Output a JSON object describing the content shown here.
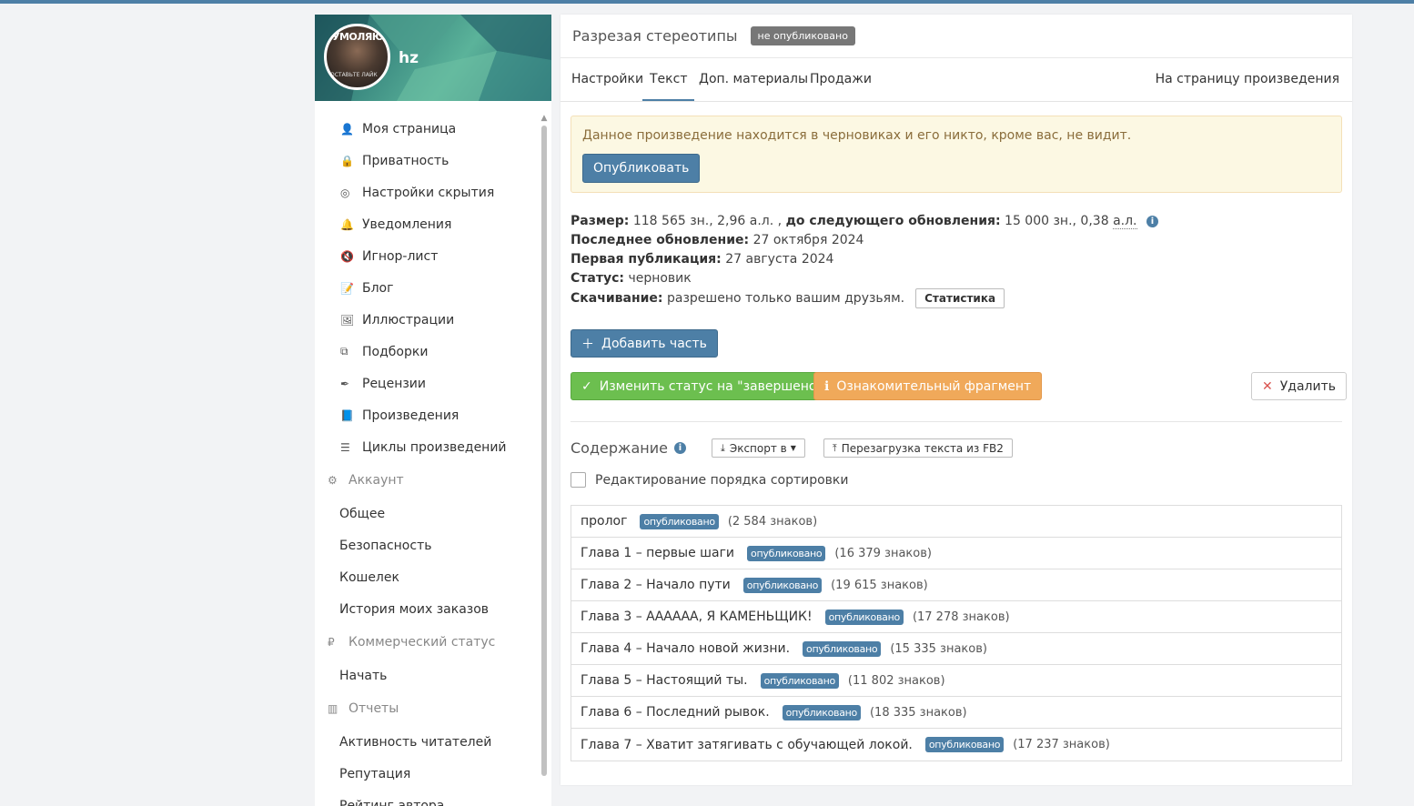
{
  "profile": {
    "username": "hz",
    "avatar_text_top": "УМОЛЯЮ",
    "avatar_text_bottom": "ОСТАВЬТЕ ЛАЙК"
  },
  "sidebar": {
    "items": [
      {
        "label": "Моя страница",
        "icon": "user-icon"
      },
      {
        "label": "Приватность",
        "icon": "lock-icon"
      },
      {
        "label": "Настройки скрытия",
        "icon": "eye-slash-icon"
      },
      {
        "label": "Уведомления",
        "icon": "bell-icon"
      },
      {
        "label": "Игнор-лист",
        "icon": "mute-icon"
      },
      {
        "label": "Блог",
        "icon": "blog-icon"
      },
      {
        "label": "Иллюстрации",
        "icon": "image-icon"
      },
      {
        "label": "Подборки",
        "icon": "collection-icon"
      },
      {
        "label": "Рецензии",
        "icon": "quill-icon"
      },
      {
        "label": "Произведения",
        "icon": "book-icon"
      },
      {
        "label": "Циклы произведений",
        "icon": "stack-icon"
      }
    ],
    "account": {
      "title": "Аккаунт",
      "items": [
        "Общее",
        "Безопасность",
        "Кошелек",
        "История моих заказов"
      ]
    },
    "commercial": {
      "title": "Коммерческий статус",
      "items": [
        "Начать"
      ]
    },
    "reports": {
      "title": "Отчеты",
      "items": [
        "Активность читателей",
        "Репутация",
        "Рейтинг автора"
      ]
    }
  },
  "header": {
    "title": "Разрезая стереотипы",
    "status_badge": "не опубликовано"
  },
  "tabs": {
    "items": [
      "Настройки",
      "Текст",
      "Доп. материалы",
      "Продажи"
    ],
    "active": "Текст",
    "right_link": "На страницу произведения"
  },
  "alert": {
    "text": "Данное произведение находится в черновиках и его никто, кроме вас, не видит.",
    "button": "Опубликовать"
  },
  "info": {
    "size_label": "Размер:",
    "size_value": "118 565 зн., 2,96 а.л. ,",
    "next_label": "до следующего обновления:",
    "next_value_a": "15 000 зн., 0,38",
    "next_value_b": "а.л.",
    "last_update_label": "Последнее обновление:",
    "last_update_value": "27 октября 2024",
    "first_pub_label": "Первая публикация:",
    "first_pub_value": "27 августа 2024",
    "status_label": "Статус:",
    "status_value": "черновик",
    "download_label": "Скачивание:",
    "download_value": "разрешено только вашим друзьям.",
    "stats_button": "Статистика"
  },
  "actions": {
    "add_part": "Добавить часть",
    "change_status": "Изменить статус на \"завершено\"",
    "intro_fragment": "Ознакомительный фрагмент",
    "delete": "Удалить"
  },
  "toc": {
    "title": "Содержание",
    "export": "Экспорт в",
    "reload": "Перезагрузка текста из FB2",
    "sort_label": "Редактирование порядка сортировки",
    "chapters": [
      {
        "title": "пролог",
        "status": "опубликовано",
        "chars": "(2 584 знаков)"
      },
      {
        "title": "Глава 1 – первые шаги",
        "status": "опубликовано",
        "chars": "(16 379 знаков)"
      },
      {
        "title": "Глава 2 – Начало пути",
        "status": "опубликовано",
        "chars": "(19 615 знаков)"
      },
      {
        "title": "Глава 3 – АААААА, Я КАМЕНЬЩИК!",
        "status": "опубликовано",
        "chars": "(17 278 знаков)"
      },
      {
        "title": "Глава 4 – Начало новой жизни.",
        "status": "опубликовано",
        "chars": "(15 335 знаков)"
      },
      {
        "title": "Глава 5 – Настоящий ты.",
        "status": "опубликовано",
        "chars": "(11 802 знаков)"
      },
      {
        "title": "Глава 6 – Последний рывок.",
        "status": "опубликовано",
        "chars": "(18 335 знаков)"
      },
      {
        "title": "Глава 7 – Хватит затягивать с обучающей локой.",
        "status": "опубликовано",
        "chars": "(17 237 знаков)"
      }
    ]
  },
  "colors": {
    "primary": "#4d7fa6",
    "success": "#6cbf4f",
    "warning": "#f0a95a",
    "alert_bg": "#fcf8e3",
    "alert_text": "#8a6d3b"
  }
}
